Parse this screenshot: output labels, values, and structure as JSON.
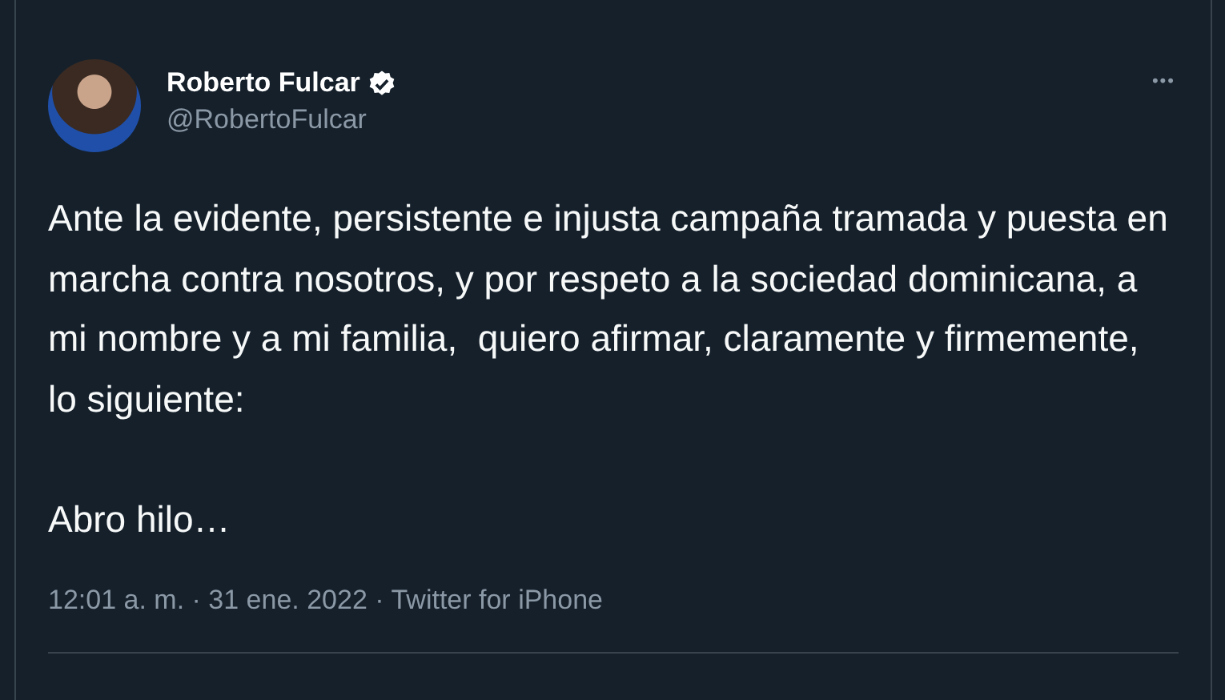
{
  "tweet": {
    "name": "Roberto Fulcar",
    "verified": true,
    "handle": "@RobertoFulcar",
    "menu": "•••",
    "text": "Ante la evidente, persistente e injusta campaña tramada y puesta en marcha contra nosotros, y por respeto a la sociedad dominicana, a mi nombre y a mi familia,  quiero afirmar, claramente y firmemente, lo siguiente:\n\nAbro hilo…",
    "meta": "12:01 a. m. · 31 ene. 2022 · Twitter for iPhone"
  }
}
